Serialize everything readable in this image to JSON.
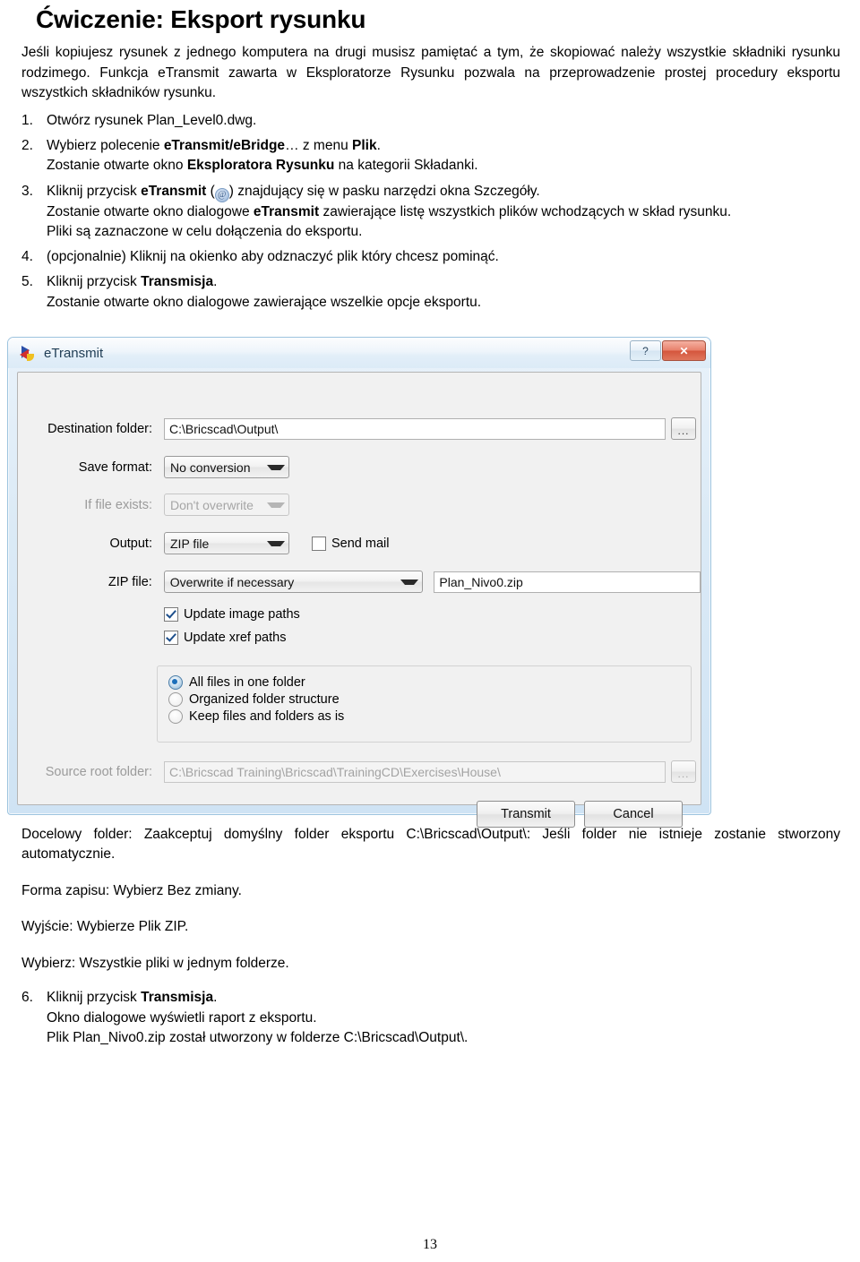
{
  "document": {
    "title": "Ćwiczenie: Eksport rysunku",
    "intro": "Jeśli kopiujesz rysunek z jednego komputera na drugi musisz pamiętać a tym, że skopiować należy wszystkie składniki rysunku rodzimego. Funkcja eTransmit zawarta w Eksploratorze Rysunku pozwala na przeprowadzenie prostej procedury eksportu wszystkich składników rysunku.",
    "steps": [
      {
        "num": "1.",
        "lines": [
          {
            "text": "Otwórz rysunek Plan_Level0.dwg."
          }
        ]
      },
      {
        "num": "2.",
        "lines": [
          {
            "pre": "Wybierz polecenie ",
            "bold": "eTransmit/eBridge",
            "mid": "… z menu ",
            "bold2": "Plik",
            "post": "."
          },
          {
            "pre": "Zostanie otwarte okno ",
            "bold": "Eksploratora Rysunku",
            "post": " na kategorii Składanki."
          }
        ]
      },
      {
        "num": "3.",
        "lines": [
          {
            "pre": "Kliknij przycisk ",
            "bold": "eTransmit",
            "icon": "@",
            "post": ") znajdujący się w pasku narzędzi okna Szczegóły.",
            "openparen": " ("
          },
          {
            "pre": "Zostanie otwarte okno dialogowe ",
            "bold": "eTransmit",
            "post": " zawierające listę wszystkich plików wchodzących w skład rysunku."
          },
          {
            "text": "Pliki są zaznaczone w celu dołączenia do eksportu."
          }
        ]
      },
      {
        "num": "4.",
        "lines": [
          {
            "text": "(opcjonalnie) Kliknij na okienko aby odznaczyć plik który chcesz pominąć."
          }
        ]
      },
      {
        "num": "5.",
        "lines": [
          {
            "pre": "Kliknij przycisk ",
            "bold": "Transmisja",
            "post": "."
          },
          {
            "text": "Zostanie otwarte okno dialogowe zawierające wszelkie opcje eksportu."
          }
        ]
      }
    ],
    "notes": [
      "Docelowy folder: Zaakceptuj domyślny folder eksportu C:\\Bricscad\\Output\\: Jeśli folder nie istnieje zostanie stworzony automatycznie.",
      "Forma zapisu: Wybierz Bez zmiany.",
      "Wyjście: Wybierze Plik ZIP.",
      "Wybierz: Wszystkie pliki w jednym folderze."
    ],
    "final_step": {
      "num": "6.",
      "line1_pre": "Kliknij przycisk ",
      "line1_bold": "Transmisja",
      "line1_post": ".",
      "line2": "Okno dialogowe wyświetli raport z eksportu.",
      "line3": "Plik Plan_Nivo0.zip  został utworzony w folderze C:\\Bricscad\\Output\\."
    },
    "page_number": "13"
  },
  "dialog": {
    "title": "eTransmit",
    "icon_name": "etransmit-app-icon",
    "help_button": "?",
    "close_button": "✕",
    "fields": {
      "destination_folder": {
        "label": "Destination folder:",
        "value": "C:\\Bricscad\\Output\\",
        "browse": "..."
      },
      "save_format": {
        "label": "Save format:",
        "value": "No conversion"
      },
      "if_file_exists": {
        "label": "If file exists:",
        "value": "Don't overwrite",
        "disabled": true
      },
      "output": {
        "label": "Output:",
        "value": "ZIP file"
      },
      "send_mail": {
        "label": "Send mail",
        "checked": false
      },
      "zip_file": {
        "label": "ZIP file:",
        "value": "Overwrite if necessary",
        "filename": "Plan_Nivo0.zip"
      },
      "update_image_paths": {
        "label": "Update image paths",
        "checked": true
      },
      "update_xref_paths": {
        "label": "Update xref paths",
        "checked": true
      },
      "source_root_folder": {
        "label": "Source root folder:",
        "value": "C:\\Bricscad Training\\Bricscad\\TrainingCD\\Exercises\\House\\",
        "browse": "...",
        "disabled": true
      }
    },
    "folder_structure_options": [
      {
        "label": "All files in one folder",
        "selected": true
      },
      {
        "label": "Organized folder structure",
        "selected": false
      },
      {
        "label": "Keep files and folders as is",
        "selected": false
      }
    ],
    "buttons": {
      "transmit": "Transmit",
      "cancel": "Cancel"
    }
  },
  "colors": {
    "titlebar_accent": "#dcebf7",
    "close_red": "#d4553c",
    "radio_blue": "#1c6fba",
    "check_blue": "#1d4f8c"
  }
}
